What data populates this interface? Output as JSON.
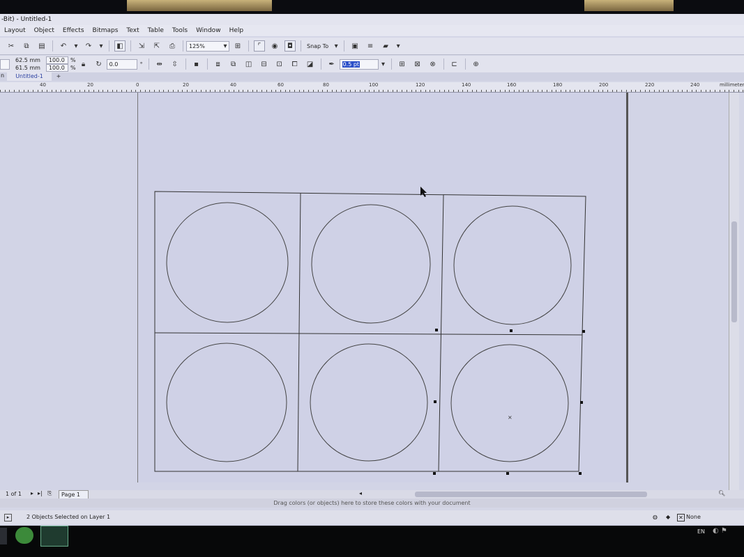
{
  "window": {
    "title": "-Bit) - Untitled-1"
  },
  "menu": [
    "Layout",
    "Object",
    "Effects",
    "Bitmaps",
    "Text",
    "Table",
    "Tools",
    "Window",
    "Help"
  ],
  "toolbar": {
    "zoom": "125%",
    "snap_to": "Snap To"
  },
  "propbar": {
    "width": "62.5 mm",
    "height": "61.5 mm",
    "scale_w": "100.0",
    "scale_h": "100.0",
    "pct": "%",
    "rotation": "0.0",
    "degree": "°",
    "outline": "0.5 pt"
  },
  "tabs": {
    "left_fragment": "n",
    "doc": "Untitled-1",
    "add": "+"
  },
  "ruler": {
    "labels": [
      "40",
      "20",
      "0",
      "20",
      "40",
      "60",
      "80",
      "100",
      "120",
      "140",
      "160",
      "180",
      "200",
      "220",
      "240"
    ],
    "unit": "millimeters"
  },
  "page_nav": {
    "count": "1 of 1",
    "page": "Page 1"
  },
  "palette_hint": "Drag colors (or objects) here to store these colors with your document",
  "status": {
    "selection": "2 Objects Selected on Layer 1",
    "fill": "None"
  },
  "taskbar": {
    "lang": "EN"
  }
}
